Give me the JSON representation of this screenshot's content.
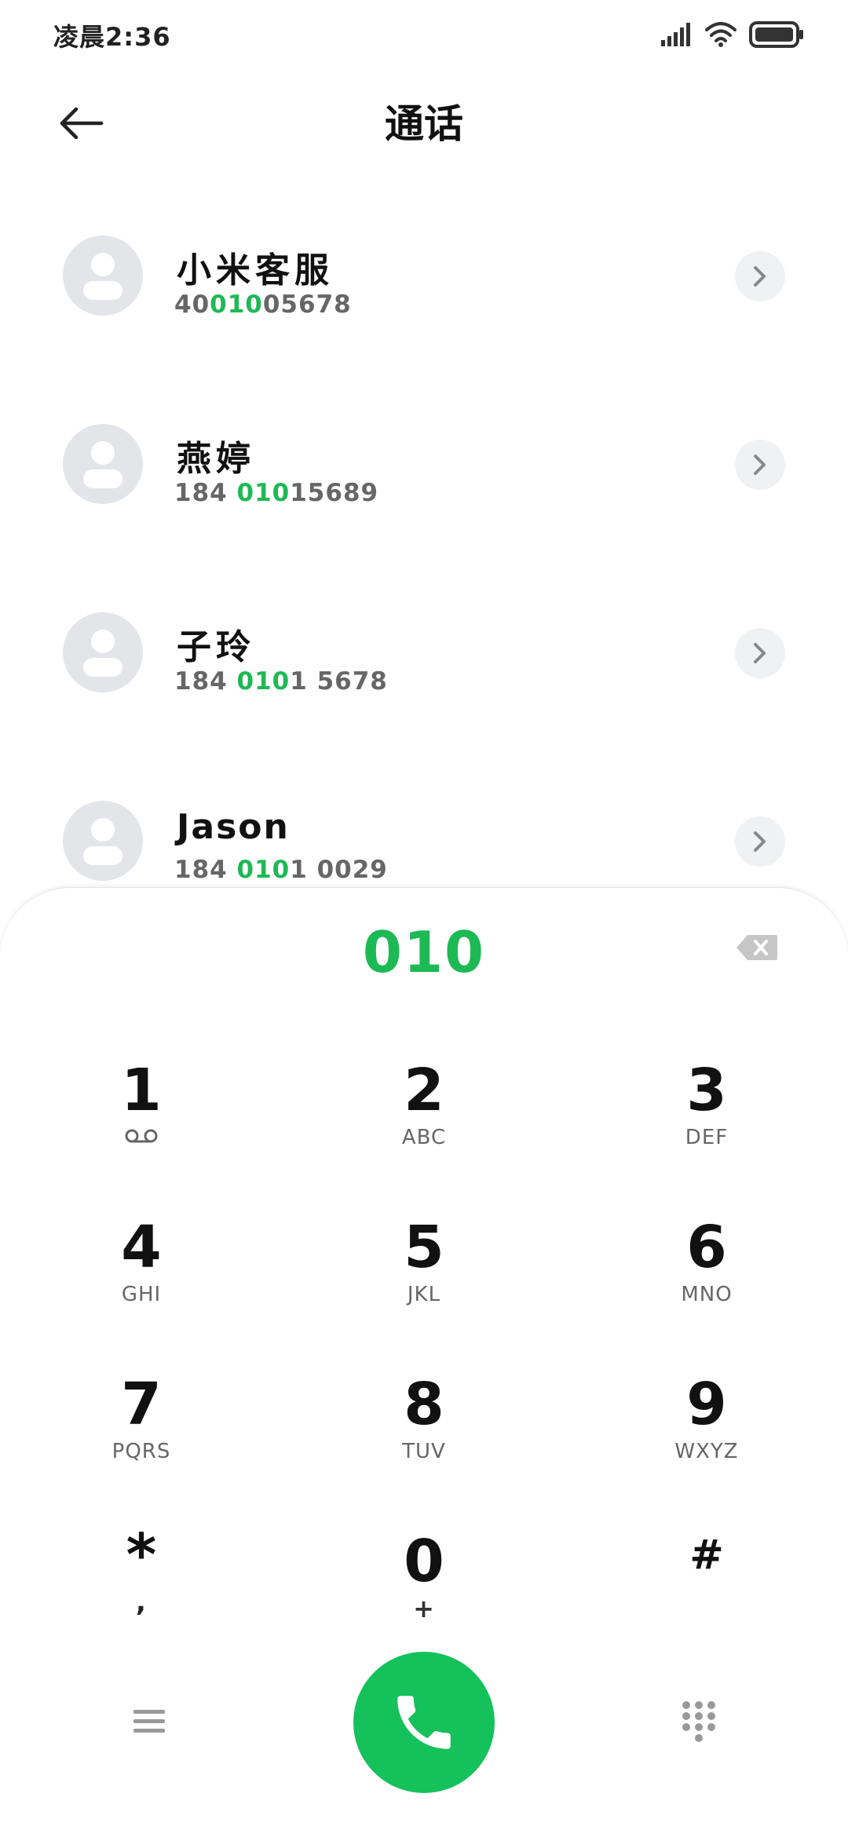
{
  "status": {
    "time": "凌晨2:36",
    "icons": [
      "signal-icon",
      "wifi-icon",
      "battery-icon"
    ]
  },
  "header": {
    "title": "通话",
    "back_icon": "arrow-left-icon"
  },
  "contacts": [
    {
      "name": "小米客服",
      "number_pre": "40",
      "number_match": "010",
      "number_post": "05678"
    },
    {
      "name": "燕婷",
      "number_pre": "184 ",
      "number_match": "010",
      "number_post": "15689"
    },
    {
      "name": "子玲",
      "number_pre": "184 ",
      "number_match": "010",
      "number_post": "1 5678"
    },
    {
      "name": "Jason",
      "number_pre": "184 ",
      "number_match": "010",
      "number_post": "1 0029"
    }
  ],
  "dialer": {
    "input": "010",
    "keys": [
      {
        "digit": "1",
        "letters": "",
        "icon": "voicemail-icon"
      },
      {
        "digit": "2",
        "letters": "ABC"
      },
      {
        "digit": "3",
        "letters": "DEF"
      },
      {
        "digit": "4",
        "letters": "GHI"
      },
      {
        "digit": "5",
        "letters": "JKL"
      },
      {
        "digit": "6",
        "letters": "MNO"
      },
      {
        "digit": "7",
        "letters": "PQRS"
      },
      {
        "digit": "8",
        "letters": "TUV"
      },
      {
        "digit": "9",
        "letters": "WXYZ"
      },
      {
        "digit": "*",
        "letters": ","
      },
      {
        "digit": "0",
        "letters": "+"
      },
      {
        "digit": "#",
        "letters": ""
      }
    ]
  },
  "colors": {
    "accent": "#1db954",
    "call_button": "#14c15a",
    "avatar_bg": "#e3e5e8"
  }
}
